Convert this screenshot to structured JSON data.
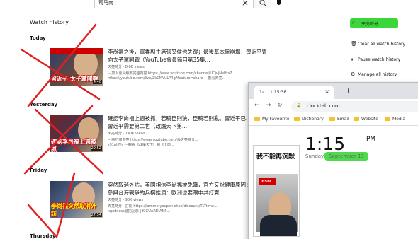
{
  "search": {
    "query": "司马南"
  },
  "history_title": "Watch history",
  "sections": [
    "Today",
    "Yesterday",
    "Friday",
    "Thursday"
  ],
  "videos": [
    {
      "title": "李尚福之後，軍委副主席張又俠也失蹤；最後基本盤崩塌，習近平胃向太子黨開戰（YouTube會員節目第35集...",
      "channel": "天亮時分 · 8.6K views",
      "desc1": "---加入會員解鎖完整內容 https://www.youtube.com/channel/UCjvjNeHrsZ...",
      "desc2": "https://youtube.com/live/ZkCMVuLPRg?feature=share ---觀看天亮...",
      "duration": "4:48",
      "caption": "習近平 太子黨開戰"
    },
    {
      "title": "確認李尚福上週被抓，若騎臣則狹，臣騎若則亂。習近平已...之言，習近平需要第二世（政論天下第...",
      "channel": "天亮時分 · 140K views",
      "desc1": "---訊訂閱天亮 https://www.youtube.com/@天亮時分...",
      "desc2": "z91nHVs ---觀看《政論天下》和《卡節...",
      "duration": "29:52",
      "caption": "確認李尚福上週被抓"
    },
    {
      "title": "突然取消外訪，美國相信李尚福被免職，官方又說健康原因：華爾街參與台海戰爭的兵棋推演：歐洲也要跟中共打賣...",
      "channel": "天亮時分 · 90K views",
      "desc1": "天亮時分 · 訂閱 https://iammeryoupen.shop/discount/TLTtime...",
      "desc2": "kgoddess發拍記念 | K-GUARDIANS...",
      "duration": "27:54",
      "caption": "李尚福突然取消外訪"
    }
  ],
  "sidebar": {
    "search_label": "天亮時分",
    "items": [
      "Clear all watch history",
      "Pause watch history",
      "Manage all history"
    ]
  },
  "browser": {
    "tab_title": "1:15:38",
    "url": "clocktab.com",
    "bookmarks": [
      "My Favourite",
      "Dictionary",
      "Email",
      "Website",
      "Media"
    ],
    "time": "1:15",
    "ampm": "PM",
    "date": "Sunday - September 17",
    "ad_title": "我不能再沉默",
    "ad_brand": "HSBC"
  }
}
